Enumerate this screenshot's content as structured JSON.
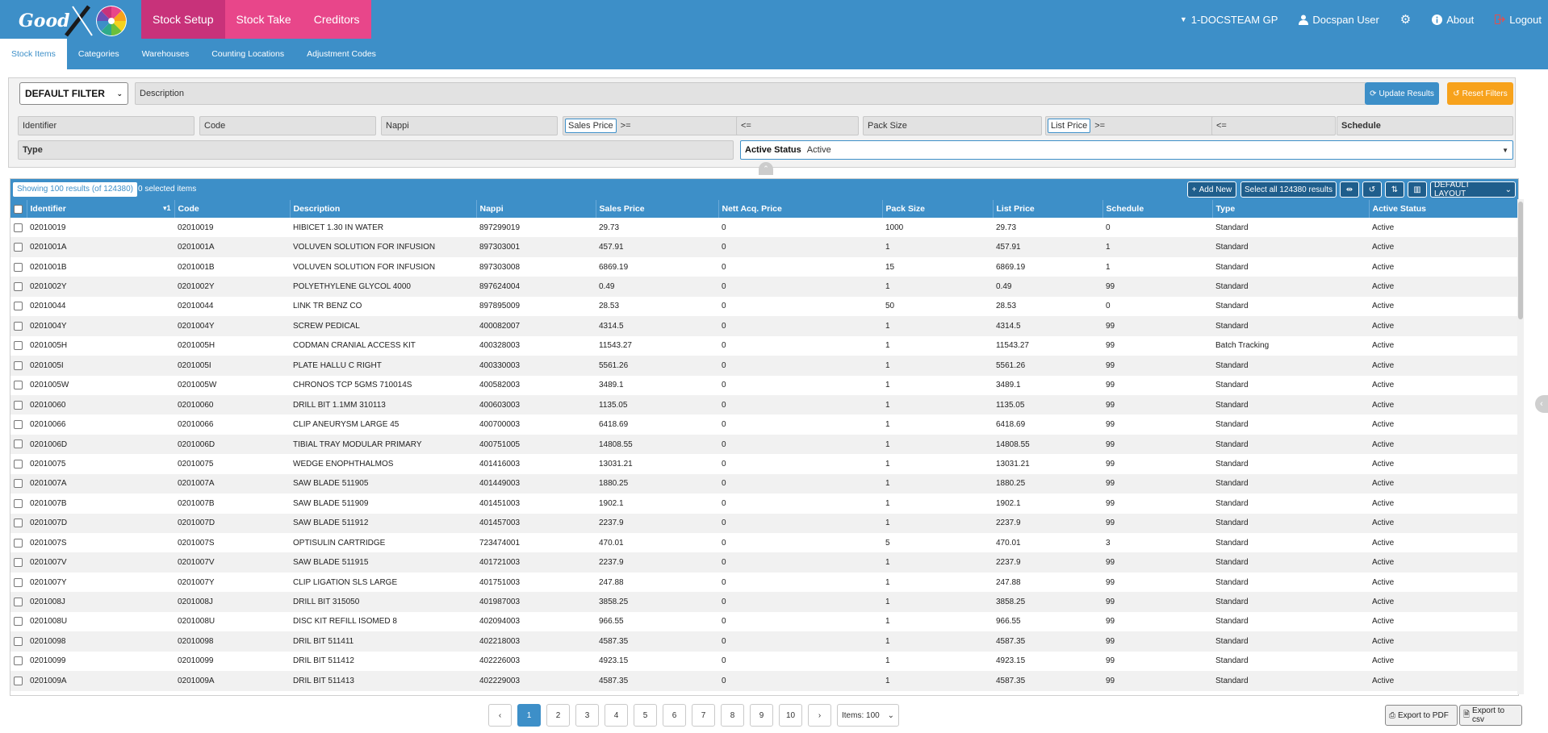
{
  "brand": {
    "logo_text": "Good"
  },
  "topnav": [
    "Stock Setup",
    "Stock Take",
    "Creditors"
  ],
  "rightnav": {
    "practice": "1-DOCSTEAM GP",
    "user": "Docspan User",
    "about": "About",
    "logout": "Logout"
  },
  "subnav": [
    "Stock Items",
    "Categories",
    "Warehouses",
    "Counting Locations",
    "Adjustment Codes"
  ],
  "filters": {
    "preset": "DEFAULT FILTER",
    "description": "Description",
    "update_label": "Update Results",
    "reset_label": "Reset Filters",
    "identifier": "Identifier",
    "code": "Code",
    "nappi": "Nappi",
    "sales_price": "Sales Price",
    "gte": ">=",
    "lte": "<=",
    "pack_size": "Pack Size",
    "list_price": "List Price",
    "schedule": "Schedule",
    "type": "Type",
    "active_status_label": "Active Status",
    "active_status_value": "Active"
  },
  "toolbar": {
    "showing": "Showing 100 results (of 124380)",
    "selected": "0 selected items",
    "add_new": "Add New",
    "select_all": "Select all 124380 results",
    "layout": "DEFAULT LAYOUT"
  },
  "columns": [
    "Identifier",
    "Code",
    "Description",
    "Nappi",
    "Sales Price",
    "Nett Acq. Price",
    "Pack Size",
    "List Price",
    "Schedule",
    "Type",
    "Active Status"
  ],
  "sort_indicator": "1",
  "rows": [
    [
      "02010019",
      "02010019",
      "HIBICET 1.30 IN WATER",
      "897299019",
      "29.73",
      "0",
      "1000",
      "29.73",
      "0",
      "Standard",
      "Active"
    ],
    [
      "0201001A",
      "0201001A",
      "VOLUVEN SOLUTION FOR INFUSION",
      "897303001",
      "457.91",
      "0",
      "1",
      "457.91",
      "1",
      "Standard",
      "Active"
    ],
    [
      "0201001B",
      "0201001B",
      "VOLUVEN SOLUTION FOR INFUSION",
      "897303008",
      "6869.19",
      "0",
      "15",
      "6869.19",
      "1",
      "Standard",
      "Active"
    ],
    [
      "0201002Y",
      "0201002Y",
      "POLYETHYLENE GLYCOL 4000",
      "897624004",
      "0.49",
      "0",
      "1",
      "0.49",
      "99",
      "Standard",
      "Active"
    ],
    [
      "02010044",
      "02010044",
      "LINK TR BENZ CO",
      "897895009",
      "28.53",
      "0",
      "50",
      "28.53",
      "0",
      "Standard",
      "Active"
    ],
    [
      "0201004Y",
      "0201004Y",
      "SCREW PEDICAL",
      "400082007",
      "4314.5",
      "0",
      "1",
      "4314.5",
      "99",
      "Standard",
      "Active"
    ],
    [
      "0201005H",
      "0201005H",
      "CODMAN CRANIAL ACCESS KIT",
      "400328003",
      "11543.27",
      "0",
      "1",
      "11543.27",
      "99",
      "Batch Tracking",
      "Active"
    ],
    [
      "0201005I",
      "0201005I",
      "PLATE HALLU C RIGHT",
      "400330003",
      "5561.26",
      "0",
      "1",
      "5561.26",
      "99",
      "Standard",
      "Active"
    ],
    [
      "0201005W",
      "0201005W",
      "CHRONOS TCP 5GMS 710014S",
      "400582003",
      "3489.1",
      "0",
      "1",
      "3489.1",
      "99",
      "Standard",
      "Active"
    ],
    [
      "02010060",
      "02010060",
      "DRILL BIT 1.1MM 310113",
      "400603003",
      "1135.05",
      "0",
      "1",
      "1135.05",
      "99",
      "Standard",
      "Active"
    ],
    [
      "02010066",
      "02010066",
      "CLIP ANEURYSM LARGE 45",
      "400700003",
      "6418.69",
      "0",
      "1",
      "6418.69",
      "99",
      "Standard",
      "Active"
    ],
    [
      "0201006D",
      "0201006D",
      "TIBIAL TRAY MODULAR PRIMARY",
      "400751005",
      "14808.55",
      "0",
      "1",
      "14808.55",
      "99",
      "Standard",
      "Active"
    ],
    [
      "02010075",
      "02010075",
      "WEDGE ENOPHTHALMOS",
      "401416003",
      "13031.21",
      "0",
      "1",
      "13031.21",
      "99",
      "Standard",
      "Active"
    ],
    [
      "0201007A",
      "0201007A",
      "SAW BLADE 511905",
      "401449003",
      "1880.25",
      "0",
      "1",
      "1880.25",
      "99",
      "Standard",
      "Active"
    ],
    [
      "0201007B",
      "0201007B",
      "SAW BLADE 511909",
      "401451003",
      "1902.1",
      "0",
      "1",
      "1902.1",
      "99",
      "Standard",
      "Active"
    ],
    [
      "0201007D",
      "0201007D",
      "SAW BLADE 511912",
      "401457003",
      "2237.9",
      "0",
      "1",
      "2237.9",
      "99",
      "Standard",
      "Active"
    ],
    [
      "0201007S",
      "0201007S",
      "OPTISULIN CARTRIDGE",
      "723474001",
      "470.01",
      "0",
      "5",
      "470.01",
      "3",
      "Standard",
      "Active"
    ],
    [
      "0201007V",
      "0201007V",
      "SAW BLADE 511915",
      "401721003",
      "2237.9",
      "0",
      "1",
      "2237.9",
      "99",
      "Standard",
      "Active"
    ],
    [
      "0201007Y",
      "0201007Y",
      "CLIP LIGATION SLS LARGE",
      "401751003",
      "247.88",
      "0",
      "1",
      "247.88",
      "99",
      "Standard",
      "Active"
    ],
    [
      "0201008J",
      "0201008J",
      "DRILL BIT 315050",
      "401987003",
      "3858.25",
      "0",
      "1",
      "3858.25",
      "99",
      "Standard",
      "Active"
    ],
    [
      "0201008U",
      "0201008U",
      "DISC KIT REFILL ISOMED 8",
      "402094003",
      "966.55",
      "0",
      "1",
      "966.55",
      "99",
      "Standard",
      "Active"
    ],
    [
      "02010098",
      "02010098",
      "DRIL BIT 511411",
      "402218003",
      "4587.35",
      "0",
      "1",
      "4587.35",
      "99",
      "Standard",
      "Active"
    ],
    [
      "02010099",
      "02010099",
      "DRIL BIT 511412",
      "402226003",
      "4923.15",
      "0",
      "1",
      "4923.15",
      "99",
      "Standard",
      "Active"
    ],
    [
      "0201009A",
      "0201009A",
      "DRIL BIT 511413",
      "402229003",
      "4587.35",
      "0",
      "1",
      "4587.35",
      "99",
      "Standard",
      "Active"
    ]
  ],
  "pager": {
    "prev": "‹",
    "next": "›",
    "pages": [
      "1",
      "2",
      "3",
      "4",
      "5",
      "6",
      "7",
      "8",
      "9",
      "10"
    ],
    "items": "Items: 100"
  },
  "export": {
    "pdf": "Export to PDF",
    "csv": "Export to csv"
  },
  "colors": {
    "primary": "#3d8fc8",
    "pink": "#e8468a",
    "orange": "#f7a21c"
  }
}
